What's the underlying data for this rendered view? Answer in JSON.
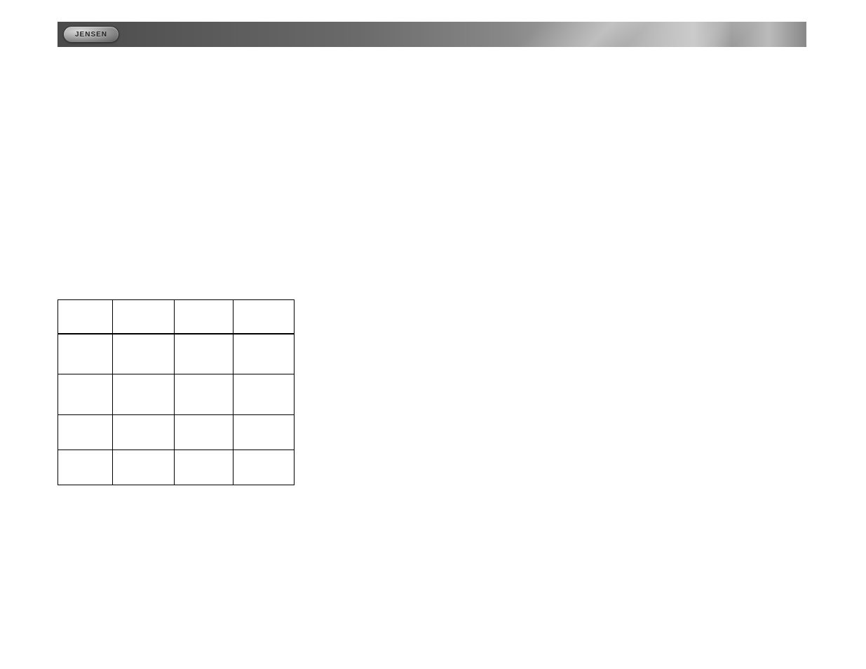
{
  "header": {
    "logo_text": "JENSEN"
  },
  "table": {
    "headers": [
      "",
      "",
      "",
      ""
    ],
    "rows": [
      [
        "",
        "",
        "",
        ""
      ],
      [
        "",
        "",
        "",
        ""
      ],
      [
        "",
        "",
        "",
        ""
      ],
      [
        "",
        "",
        "",
        ""
      ]
    ]
  }
}
